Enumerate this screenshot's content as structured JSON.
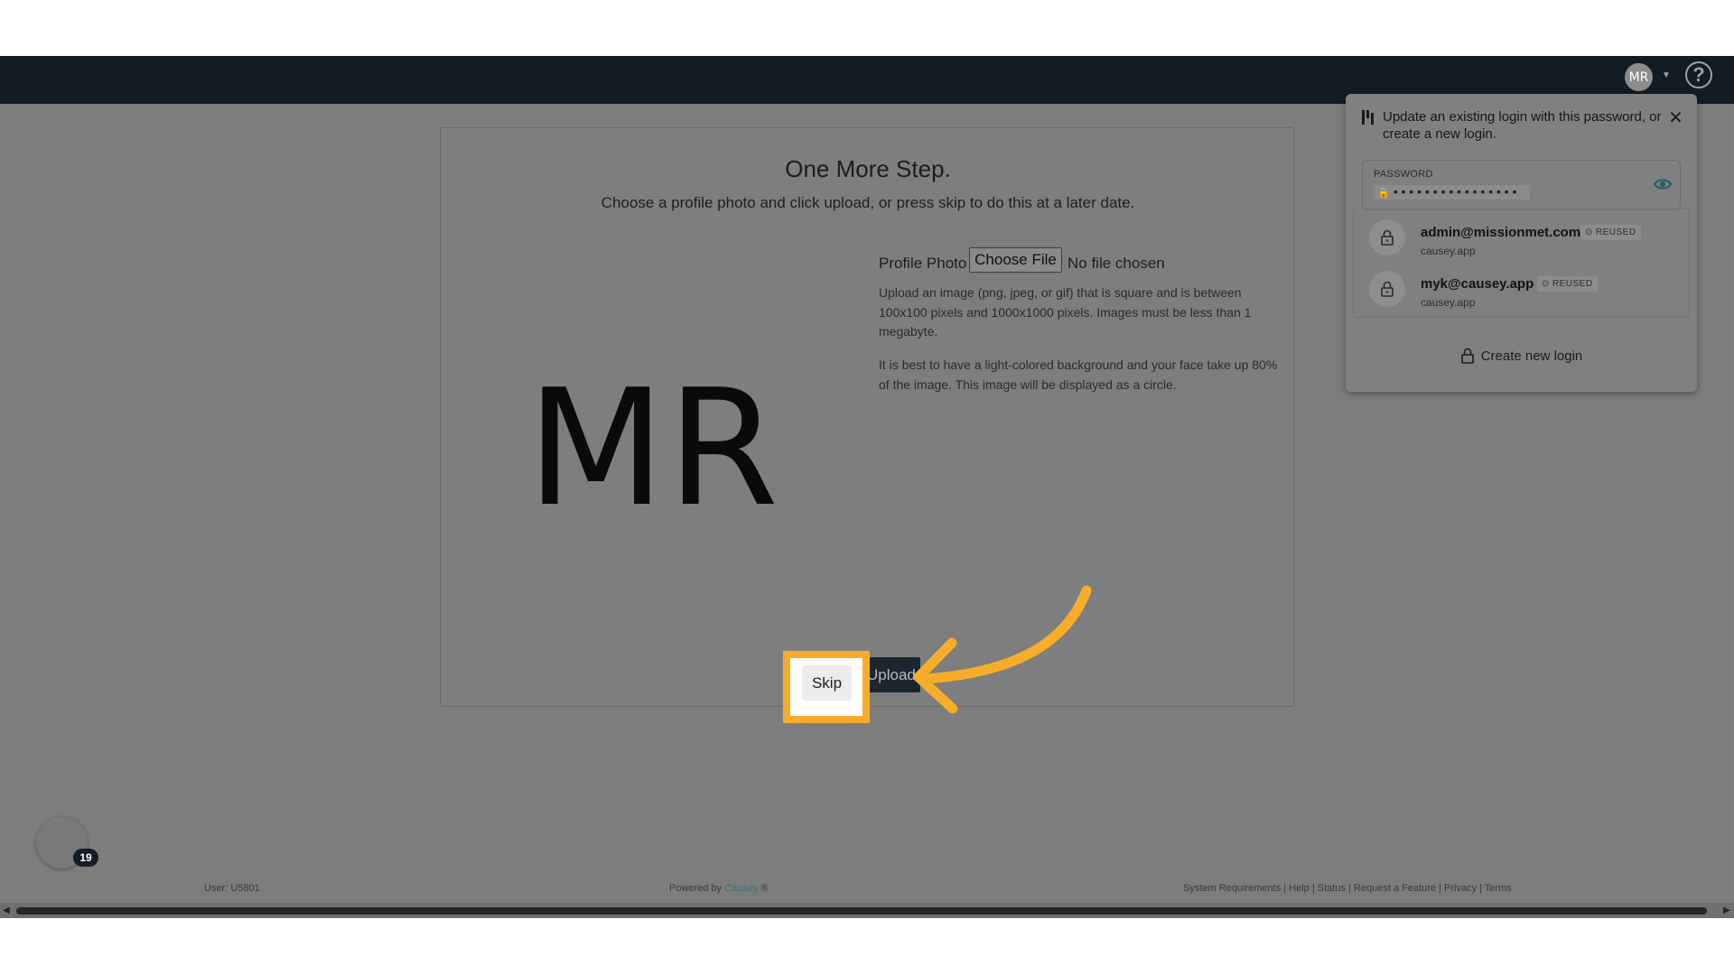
{
  "header": {
    "avatar_initials": "MR",
    "help_icon": "question-circle-icon"
  },
  "card": {
    "title": "One More Step.",
    "subtitle": "Choose a profile photo and click upload, or press skip to do this at a later date.",
    "initials": "MR",
    "profile_photo_label": "Profile Photo",
    "choose_file_label": "Choose File",
    "no_file_text": "No file chosen",
    "help_text_1": "Upload an image (png, jpeg, or gif) that is square and is between 100x100 pixels and 1000x1000 pixels. Images must be less than 1 megabyte.",
    "help_text_2": "It is best to have a light-colored background and your face take up 80% of the image. This image will be displayed as a circle.",
    "skip_label": "Skip",
    "upload_label": "Upload"
  },
  "password_popup": {
    "heading": "Update an existing login with this password, or create a new login.",
    "password_label": "PASSWORD",
    "password_value": "• • • • • • • • • • • • • • • •",
    "logins": [
      {
        "email": "admin@missionmet.com",
        "site": "causey.app",
        "badge": "REUSED"
      },
      {
        "email": "myk@causey.app",
        "site": "causey.app",
        "badge": "REUSED"
      }
    ],
    "create_label": "Create new login"
  },
  "chat": {
    "badge_count": "19"
  },
  "footer": {
    "user": "User: U5801",
    "powered_prefix": "Powered by ",
    "powered_brand": "Causey",
    "powered_suffix": " ®",
    "links": "System Requirements | Help | Status | Request a Feature | Privacy | Terms"
  },
  "colors": {
    "highlight": "#f7ad2a",
    "topbar": "#121c24"
  }
}
